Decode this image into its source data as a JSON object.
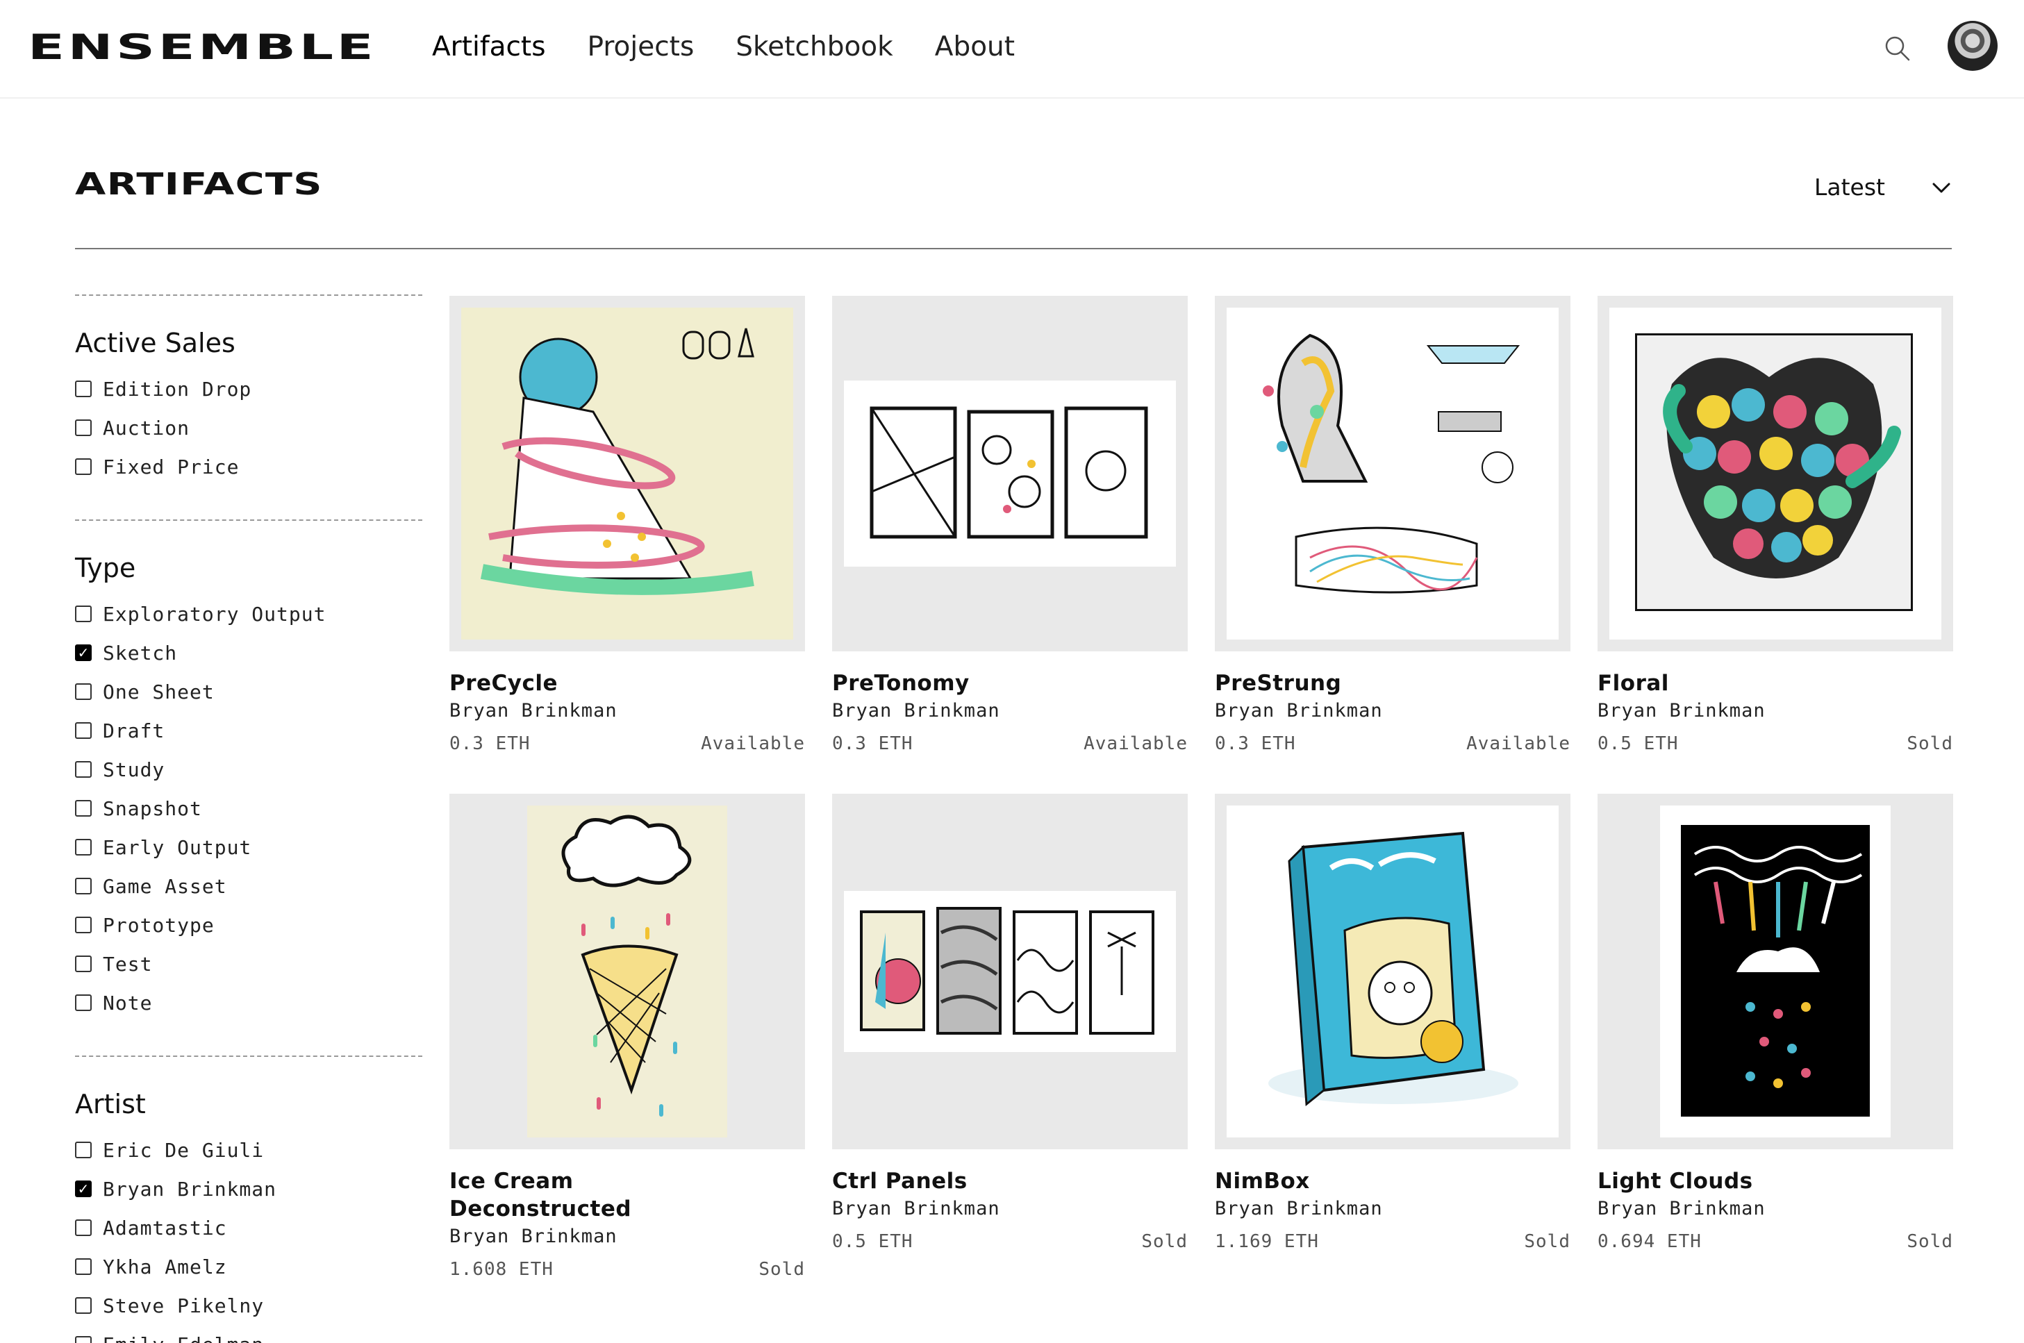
{
  "header": {
    "logo": "ENSEMBLE",
    "nav": [
      "Artifacts",
      "Projects",
      "Sketchbook",
      "About"
    ],
    "active_nav": "Artifacts"
  },
  "page": {
    "title": "ARTIFACTS",
    "sort_label": "Latest"
  },
  "filters": {
    "active_sales": {
      "title": "Active Sales",
      "options": [
        {
          "label": "Edition Drop",
          "checked": false
        },
        {
          "label": "Auction",
          "checked": false
        },
        {
          "label": "Fixed Price",
          "checked": false
        }
      ]
    },
    "type": {
      "title": "Type",
      "options": [
        {
          "label": "Exploratory Output",
          "checked": false
        },
        {
          "label": "Sketch",
          "checked": true
        },
        {
          "label": "One Sheet",
          "checked": false
        },
        {
          "label": "Draft",
          "checked": false
        },
        {
          "label": "Study",
          "checked": false
        },
        {
          "label": "Snapshot",
          "checked": false
        },
        {
          "label": "Early Output",
          "checked": false
        },
        {
          "label": "Game Asset",
          "checked": false
        },
        {
          "label": "Prototype",
          "checked": false
        },
        {
          "label": "Test",
          "checked": false
        },
        {
          "label": "Note",
          "checked": false
        }
      ]
    },
    "artist": {
      "title": "Artist",
      "options": [
        {
          "label": "Eric De Giuli",
          "checked": false
        },
        {
          "label": "Bryan Brinkman",
          "checked": true
        },
        {
          "label": "Adamtastic",
          "checked": false
        },
        {
          "label": "Ykha Amelz",
          "checked": false
        },
        {
          "label": "Steve Pikelny",
          "checked": false
        },
        {
          "label": "Emily Edelman",
          "checked": false
        }
      ]
    }
  },
  "artifacts": [
    {
      "title": "PreCycle",
      "artist": "Bryan Brinkman",
      "price": "0.3 ETH",
      "status": "Available"
    },
    {
      "title": "PreTonomy",
      "artist": "Bryan Brinkman",
      "price": "0.3 ETH",
      "status": "Available"
    },
    {
      "title": "PreStrung",
      "artist": "Bryan Brinkman",
      "price": "0.3 ETH",
      "status": "Available"
    },
    {
      "title": "Floral",
      "artist": "Bryan Brinkman",
      "price": "0.5 ETH",
      "status": "Sold"
    },
    {
      "title": "Ice Cream Deconstructed",
      "artist": "Bryan Brinkman",
      "price": "1.608 ETH",
      "status": "Sold"
    },
    {
      "title": "Ctrl Panels",
      "artist": "Bryan Brinkman",
      "price": "0.5 ETH",
      "status": "Sold"
    },
    {
      "title": "NimBox",
      "artist": "Bryan Brinkman",
      "price": "1.169 ETH",
      "status": "Sold"
    },
    {
      "title": "Light Clouds",
      "artist": "Bryan Brinkman",
      "price": "0.694 ETH",
      "status": "Sold"
    }
  ],
  "colors": {
    "thumb_bg": "#e9e9e9",
    "text": "#111111",
    "muted": "#555555"
  }
}
